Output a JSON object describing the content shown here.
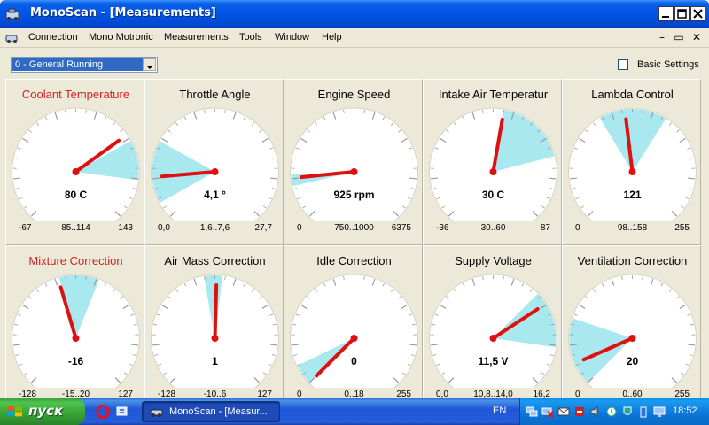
{
  "window": {
    "title": "MonoScan - [Measurements]"
  },
  "menu": {
    "items": [
      "Connection",
      "Mono Motronic",
      "Measurements",
      "Tools",
      "Window",
      "Help"
    ]
  },
  "toolbar": {
    "group_select_value": "0 - General Running",
    "basic_settings_label": "Basic Settings",
    "basic_settings_checked": false
  },
  "colors": {
    "needle": "#e01010",
    "range_band": "#a8e8ee",
    "highlight_title": "#d42020",
    "title_normal": "#000000"
  },
  "gauges": [
    {
      "title": "Coolant Temperature",
      "value_text": "80 C",
      "min": "-67",
      "range": "85..114",
      "max": "143",
      "highlight": true,
      "min_value": -67,
      "max_value": 143,
      "value": 80,
      "band_from": 85,
      "band_to": 114
    },
    {
      "title": "Throttle Angle",
      "value_text": "4,1 °",
      "min": "0,0",
      "range": "1,6..7,6",
      "max": "27,7",
      "highlight": false,
      "min_value": 0,
      "max_value": 27.7,
      "value": 4.1,
      "band_from": 1.6,
      "band_to": 7.6
    },
    {
      "title": "Engine Speed",
      "value_text": "925 rpm",
      "min": "0",
      "range": "750..1000",
      "max": "6375",
      "highlight": false,
      "min_value": 0,
      "max_value": 6375,
      "value": 925,
      "band_from": 750,
      "band_to": 1000
    },
    {
      "title": "Intake Air Temperatur",
      "value_text": "30 C",
      "min": "-36",
      "range": "30..60",
      "max": "87",
      "highlight": false,
      "min_value": -36,
      "max_value": 87,
      "value": 30,
      "band_from": 30,
      "band_to": 60
    },
    {
      "title": "Lambda Control",
      "value_text": "121",
      "min": "0",
      "range": "98..158",
      "max": "255",
      "highlight": false,
      "min_value": 0,
      "max_value": 255,
      "value": 121,
      "band_from": 98,
      "band_to": 158
    },
    {
      "title": "Mixture Correction",
      "value_text": "-16",
      "min": "-128",
      "range": "-15..20",
      "max": "127",
      "highlight": true,
      "min_value": -128,
      "max_value": 127,
      "value": -16,
      "band_from": -15,
      "band_to": 20
    },
    {
      "title": "Air Mass Correction",
      "value_text": "1",
      "min": "-128",
      "range": "-10..6",
      "max": "127",
      "highlight": false,
      "min_value": -128,
      "max_value": 127,
      "value": 1,
      "band_from": -10,
      "band_to": 6
    },
    {
      "title": "Idle Correction",
      "value_text": "0",
      "min": "0",
      "range": "0..18",
      "max": "255",
      "highlight": false,
      "min_value": 0,
      "max_value": 255,
      "value": 0,
      "band_from": 0,
      "band_to": 18
    },
    {
      "title": "Supply Voltage",
      "value_text": "11,5 V",
      "min": "0,0",
      "range": "10,8..14,0",
      "max": "16,2",
      "highlight": false,
      "min_value": 0,
      "max_value": 16.2,
      "value": 11.5,
      "band_from": 10.8,
      "band_to": 14.0
    },
    {
      "title": "Ventilation Correction",
      "value_text": "20",
      "min": "0",
      "range": "0..60",
      "max": "255",
      "highlight": false,
      "min_value": 0,
      "max_value": 255,
      "value": 20,
      "band_from": 0,
      "band_to": 60
    }
  ],
  "taskbar": {
    "start_label": "пуск",
    "task_label": "MonoScan - [Measur...",
    "language": "EN",
    "clock": "18:52"
  }
}
